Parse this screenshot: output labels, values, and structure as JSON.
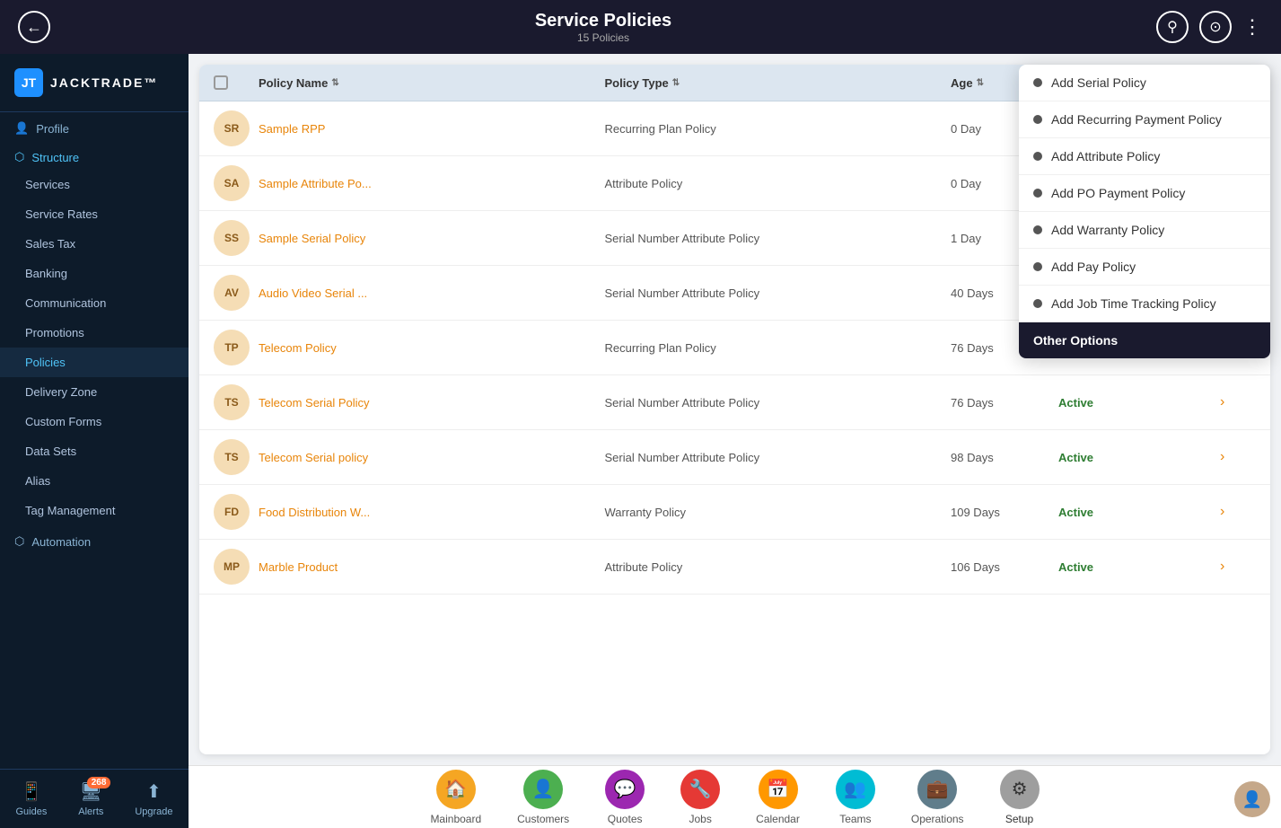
{
  "header": {
    "title": "Service Policies",
    "subtitle": "15 Policies",
    "back_label": "←",
    "search_label": "⌕",
    "filter_label": "⊙",
    "more_label": "⋮"
  },
  "sidebar": {
    "logo_text": "JACKTRADE™",
    "sections": [
      {
        "label": "Profile",
        "icon": "👤",
        "items": []
      },
      {
        "label": "Structure",
        "icon": "⬡",
        "items": [
          {
            "label": "Services",
            "active": false
          },
          {
            "label": "Service Rates",
            "active": false
          },
          {
            "label": "Sales Tax",
            "active": false
          },
          {
            "label": "Banking",
            "active": false
          },
          {
            "label": "Communication",
            "active": false
          },
          {
            "label": "Promotions",
            "active": false
          },
          {
            "label": "Policies",
            "active": true
          },
          {
            "label": "Delivery Zone",
            "active": false
          },
          {
            "label": "Custom Forms",
            "active": false
          },
          {
            "label": "Data Sets",
            "active": false
          },
          {
            "label": "Alias",
            "active": false
          },
          {
            "label": "Tag Management",
            "active": false
          }
        ]
      },
      {
        "label": "Automation",
        "icon": "⬡",
        "items": []
      }
    ],
    "bottom_items": [
      {
        "label": "Guides",
        "icon": "📱",
        "badge": null
      },
      {
        "label": "Alerts",
        "icon": "🖥",
        "badge": "268"
      },
      {
        "label": "Upgrade",
        "icon": "⬆",
        "badge": null
      }
    ]
  },
  "table": {
    "columns": [
      {
        "label": "",
        "key": "checkbox"
      },
      {
        "label": "Policy Name",
        "sortable": true
      },
      {
        "label": "Policy Type",
        "sortable": true
      },
      {
        "label": "Age",
        "sortable": true
      },
      {
        "label": "",
        "sortable": false
      },
      {
        "label": "",
        "sortable": false
      }
    ],
    "rows": [
      {
        "initials": "SR",
        "name": "Sample RPP",
        "type": "Recurring Plan Policy",
        "age": "0 Day",
        "status": "",
        "has_chevron": false
      },
      {
        "initials": "SA",
        "name": "Sample Attribute Po...",
        "type": "Attribute Policy",
        "age": "0 Day",
        "status": "",
        "has_chevron": false
      },
      {
        "initials": "SS",
        "name": "Sample Serial Policy",
        "type": "Serial Number Attribute Policy",
        "age": "1 Day",
        "status": "",
        "has_chevron": false
      },
      {
        "initials": "AV",
        "name": "Audio Video Serial ...",
        "type": "Serial Number Attribute Policy",
        "age": "40 Days",
        "status": "Active",
        "has_chevron": true
      },
      {
        "initials": "TP",
        "name": "Telecom Policy",
        "type": "Recurring Plan Policy",
        "age": "76 Days",
        "status": "Active",
        "has_chevron": true
      },
      {
        "initials": "TS",
        "name": "Telecom Serial Policy",
        "type": "Serial Number Attribute Policy",
        "age": "76 Days",
        "status": "Active",
        "has_chevron": true
      },
      {
        "initials": "TS",
        "name": "Telecom Serial policy",
        "type": "Serial Number Attribute Policy",
        "age": "98 Days",
        "status": "Active",
        "has_chevron": true
      },
      {
        "initials": "FD",
        "name": "Food Distribution W...",
        "type": "Warranty Policy",
        "age": "109 Days",
        "status": "Active",
        "has_chevron": true
      },
      {
        "initials": "MP",
        "name": "Marble Product",
        "type": "Attribute Policy",
        "age": "106 Days",
        "status": "Active",
        "has_chevron": true
      }
    ]
  },
  "dropdown": {
    "items": [
      {
        "label": "Add Serial Policy"
      },
      {
        "label": "Add Recurring Payment Policy"
      },
      {
        "label": "Add Attribute Policy"
      },
      {
        "label": "Add PO Payment Policy"
      },
      {
        "label": "Add Warranty Policy"
      },
      {
        "label": "Add Pay Policy"
      },
      {
        "label": "Add Job Time Tracking Policy"
      }
    ],
    "other_options_label": "Other Options"
  },
  "bottom_nav": {
    "items": [
      {
        "label": "Mainboard",
        "icon": "🏠",
        "color_class": "nav-icon-mainboard"
      },
      {
        "label": "Customers",
        "icon": "👤",
        "color_class": "nav-icon-customers"
      },
      {
        "label": "Quotes",
        "icon": "💬",
        "color_class": "nav-icon-quotes"
      },
      {
        "label": "Jobs",
        "icon": "🔧",
        "color_class": "nav-icon-jobs"
      },
      {
        "label": "Calendar",
        "icon": "📅",
        "color_class": "nav-icon-calendar"
      },
      {
        "label": "Teams",
        "icon": "👥",
        "color_class": "nav-icon-teams"
      },
      {
        "label": "Operations",
        "icon": "💼",
        "color_class": "nav-icon-operations"
      },
      {
        "label": "Setup",
        "icon": "⚙",
        "color_class": "nav-icon-setup",
        "active": true
      }
    ]
  }
}
